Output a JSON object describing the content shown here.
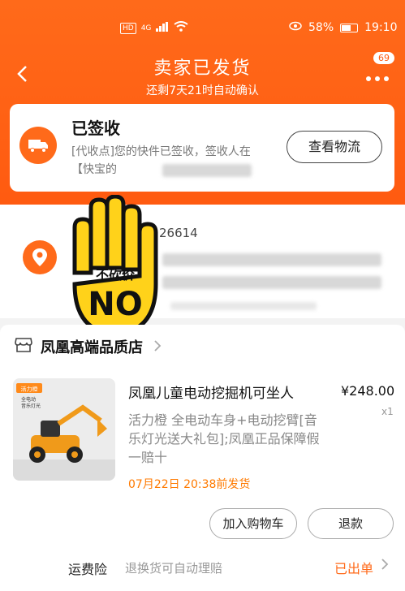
{
  "status_bar": {
    "hd": "HD",
    "network": "4G",
    "battery_percent": "58%",
    "time": "19:10"
  },
  "header": {
    "title": "卖家已发货",
    "subtitle": "还剩7天21时自动确认",
    "message_badge": "69"
  },
  "tracking": {
    "status": "已签收",
    "description": "[代收点]您的快件已签收，签收人在【快宝的",
    "button_label": "查看物流"
  },
  "address": {
    "phone_partial": "26614"
  },
  "overlay": {
    "text_top": "不砍价",
    "text_main": "NO"
  },
  "shop": {
    "name": "凤凰高端品质店"
  },
  "product": {
    "image_tag": "活力橙",
    "image_lines": [
      "全电动",
      "音乐灯光"
    ],
    "title": "凤凰儿童电动挖掘机可坐人",
    "price": "¥248.00",
    "quantity": "x1",
    "spec": "活力橙 全电动车身+电动挖臂[音乐灯光送大礼包];凤凰正品保障假一赔十",
    "ship_note": "07月22日 20:38前发货"
  },
  "actions": {
    "add_to_cart": "加入购物车",
    "refund": "退款"
  },
  "insurance": {
    "label": "运费险",
    "description": "退换货可自动理赔",
    "status": "已出单"
  },
  "colors": {
    "accent": "#ff5a10",
    "ship_note": "#ff7a00",
    "overlay_yellow": "#ffd21a"
  }
}
